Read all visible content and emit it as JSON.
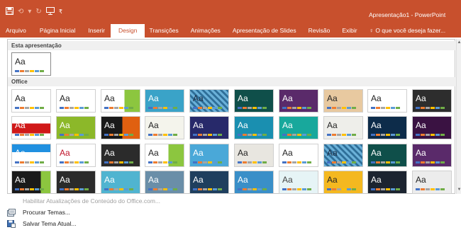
{
  "titlebar": {
    "title": "Apresentação1 - PowerPoint",
    "qat_icons": [
      "save-icon",
      "undo-icon",
      "redo-icon",
      "start-from-beginning-icon",
      "customize-qat-icon"
    ],
    "accent": "#c8502d"
  },
  "tabs": [
    {
      "label": "Arquivo"
    },
    {
      "label": "Página Inicial"
    },
    {
      "label": "Inserir"
    },
    {
      "label": "Design",
      "active": true
    },
    {
      "label": "Transições"
    },
    {
      "label": "Animações"
    },
    {
      "label": "Apresentação de Slides"
    },
    {
      "label": "Revisão"
    },
    {
      "label": "Exibir"
    }
  ],
  "tell_me": "O que você deseja fazer...",
  "gallery": {
    "section_this": "Esta apresentação",
    "section_office": "Office",
    "thumb_text": "Aa"
  },
  "menu": {
    "enable_updates": "Habilitar Atualizações de Conteúdo do Office.com...",
    "browse_themes": "Procurar Temas...",
    "save_theme": "Salvar Tema Atual..."
  },
  "swatch_palette": [
    "#4472c4",
    "#ed7d31",
    "#a5a5a5",
    "#ffc000",
    "#5b9bd5",
    "#70ad47"
  ]
}
